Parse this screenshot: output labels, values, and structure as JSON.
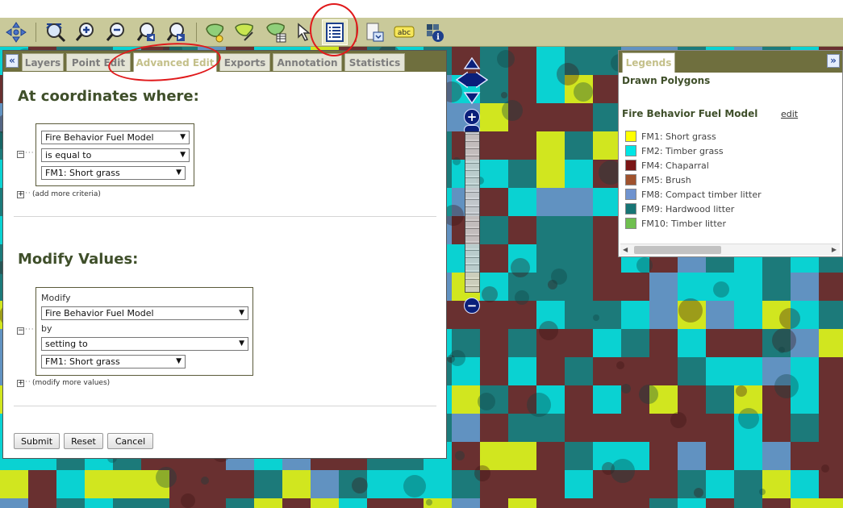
{
  "colors": {
    "fm1": "#ffff00",
    "fm2": "#00e5e5",
    "fm4": "#7a1616",
    "fm5": "#a0522d",
    "fm8": "#6f93cf",
    "fm9": "#177575",
    "fm10": "#6fbf4f"
  },
  "toolbar": {
    "buttons": [
      "pan-icon",
      "zoom-extent-icon",
      "zoom-in-icon",
      "zoom-out-icon",
      "zoom-previous-icon",
      "zoom-next-icon",
      "draw-polygon-icon",
      "edit-polygon-icon",
      "polygon-table-icon",
      "select-arrow-icon",
      "attribute-table-icon",
      "export-icon",
      "label-icon",
      "identify-icon"
    ],
    "label_text": "abc"
  },
  "panel": {
    "collapse_glyph": "«",
    "tabs": [
      "Layers",
      "Point Edit",
      "Advanced Edit",
      "Exports",
      "Annotation",
      "Statistics"
    ],
    "active_tab": "Advanced Edit",
    "criteria": {
      "title": "At coordinates where:",
      "field": "Fire Behavior Fuel Model",
      "operator": "is equal to",
      "value": "FM1: Short grass",
      "add_more": "(add more criteria)"
    },
    "modify": {
      "title": "Modify Values:",
      "modify_label": "Modify",
      "field": "Fire Behavior Fuel Model",
      "by_label": "by",
      "method": "setting to",
      "value": "FM1: Short grass",
      "add_more": "(modify more values)"
    },
    "buttons": {
      "submit": "Submit",
      "reset": "Reset",
      "cancel": "Cancel"
    }
  },
  "legend": {
    "tab": "Legends",
    "expand_glyph": "»",
    "drawn_polygons": "Drawn Polygons",
    "layer_title": "Fire Behavior Fuel Model",
    "edit_link": "edit",
    "items": [
      {
        "label": "FM1: Short grass",
        "color": "#ffff00"
      },
      {
        "label": "FM2: Timber grass",
        "color": "#00e5e5"
      },
      {
        "label": "FM4: Chaparral",
        "color": "#7a1616"
      },
      {
        "label": "FM5: Brush",
        "color": "#a0522d"
      },
      {
        "label": "FM8: Compact timber litter",
        "color": "#6f93cf"
      },
      {
        "label": "FM9: Hardwood litter",
        "color": "#177575"
      },
      {
        "label": "FM10: Timber litter",
        "color": "#6fbf4f"
      }
    ]
  },
  "nav": {
    "zoom_in": "+",
    "zoom_out": "−"
  }
}
